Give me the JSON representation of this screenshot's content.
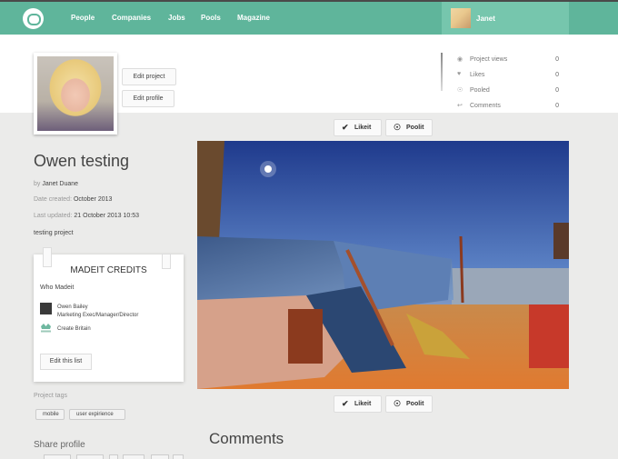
{
  "nav": {
    "items": [
      "People",
      "Companies",
      "Jobs",
      "Pools",
      "Magazine"
    ],
    "user_name": "Janet"
  },
  "header": {
    "edit_project": "Edit project",
    "edit_profile": "Edit profile"
  },
  "stats": [
    {
      "icon": "eye-icon",
      "label": "Project views",
      "value": "0"
    },
    {
      "icon": "heart-icon",
      "label": "Likes",
      "value": "0"
    },
    {
      "icon": "pool-icon",
      "label": "Pooled",
      "value": "0"
    },
    {
      "icon": "reply-icon",
      "label": "Comments",
      "value": "0"
    }
  ],
  "actions": {
    "likeit": "Likeit",
    "poolit": "Poolit"
  },
  "project": {
    "title": "Owen testing",
    "by_prefix": "by",
    "author": "Janet Duane",
    "date_created_label": "Date created:",
    "date_created": "October 2013",
    "last_updated_label": "Last updated:",
    "last_updated": "21 October 2013 10:53",
    "description": "testing project"
  },
  "credits": {
    "title": "MADEIT CREDITS",
    "who_label": "Who Madeit",
    "people": [
      {
        "name": "Owen Bailey",
        "role": "Marketing Exec/Manager/Director"
      },
      {
        "name": "Create Britain",
        "role": ""
      }
    ],
    "edit_button": "Edit this list"
  },
  "tags": {
    "label": "Project tags",
    "items": [
      "mobile",
      "user expirience"
    ]
  },
  "share_label": "Share profile",
  "comments_heading": "Comments",
  "colors": {
    "accent": "#5fb59b",
    "accent_light": "#76c6ad"
  }
}
